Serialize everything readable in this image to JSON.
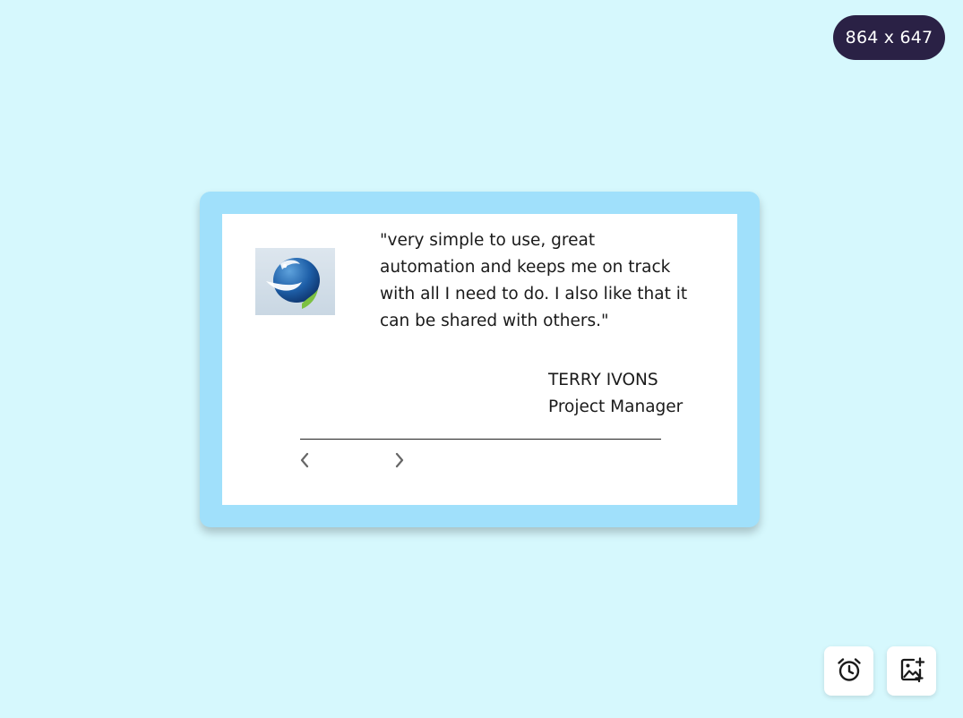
{
  "viewport_badge": {
    "label": "864 x 647"
  },
  "testimonial": {
    "quote": "\"very simple to use, great automation and keeps me on track with all I need to do. I also like that it can be shared with others.\"",
    "author_name": "TERRY IVONS",
    "author_role": "Project Manager",
    "logo_icon": "bird-logo-icon",
    "prev_icon": "chevron-left-icon",
    "next_icon": "chevron-right-icon"
  },
  "toolbar": {
    "alarm_icon": "alarm-clock-icon",
    "add_image_icon": "add-photo-icon"
  },
  "colors": {
    "page_background": "#d6f8fd",
    "card_frame": "#a0e0fb",
    "badge_background": "#2a2145",
    "logo_blue": "#1e5fa8",
    "logo_green": "#7cc142"
  }
}
